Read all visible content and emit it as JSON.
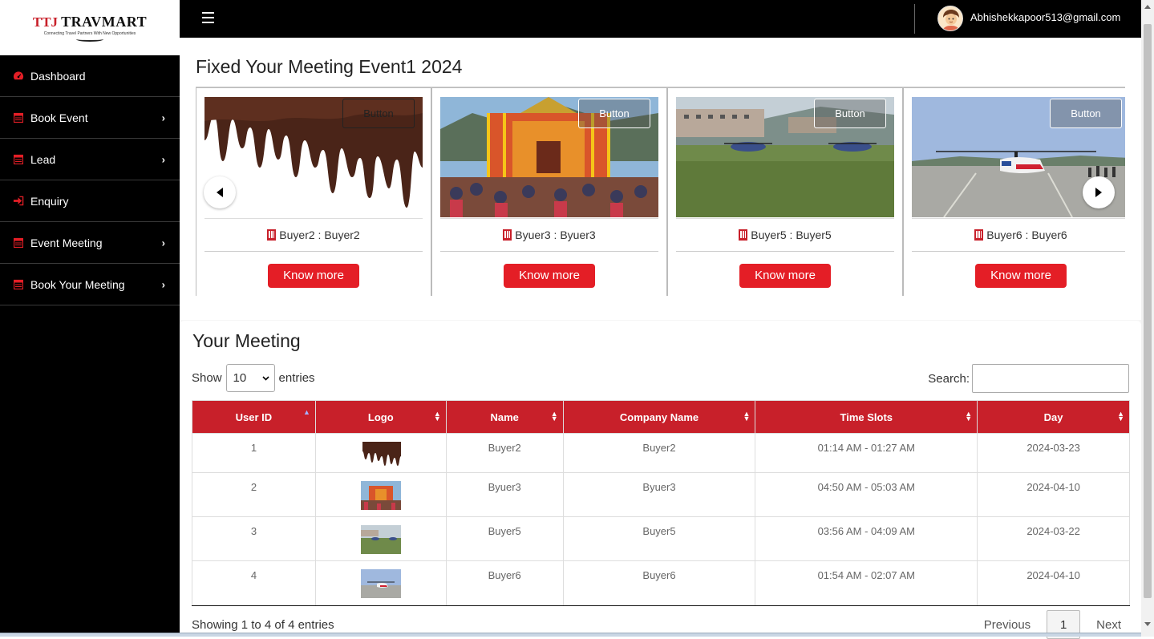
{
  "brand": {
    "logo_mark": "TTJ",
    "logo_name": "TRAVMART",
    "logo_tagline": "Connecting Travel Partners With New Opportunities"
  },
  "sidebar": {
    "items": [
      {
        "label": "Dashboard",
        "icon": "dashboard-icon",
        "has_submenu": false
      },
      {
        "label": "Book Event",
        "icon": "calendar-icon",
        "has_submenu": true
      },
      {
        "label": "Lead",
        "icon": "calendar-icon",
        "has_submenu": true
      },
      {
        "label": "Enquiry",
        "icon": "sign-in-icon",
        "has_submenu": false
      },
      {
        "label": "Event Meeting",
        "icon": "calendar-icon",
        "has_submenu": true
      },
      {
        "label": "Book Your Meeting",
        "icon": "calendar-icon",
        "has_submenu": true
      }
    ]
  },
  "topbar": {
    "user_email": "Abhishekkapoor513@gmail.com"
  },
  "carousel": {
    "title": "Fixed Your Meeting Event1 2024",
    "slides": [
      {
        "name": "Buyer2 : Buyer2",
        "button": "Button",
        "cta": "Know more",
        "image": "chocolate-drip"
      },
      {
        "name": "Byuer3 : Byuer3",
        "button": "Button",
        "cta": "Know more",
        "image": "temple"
      },
      {
        "name": "Buyer5 : Buyer5",
        "button": "Button",
        "cta": "Know more",
        "image": "helipad-field"
      },
      {
        "name": "Buyer6 : Buyer6",
        "button": "Button",
        "cta": "Know more",
        "image": "helicopter"
      }
    ]
  },
  "meetings": {
    "title": "Your Meeting",
    "show_label": "Show",
    "entries_label": "entries",
    "page_length": "10",
    "search_label": "Search:",
    "search_value": "",
    "columns": [
      "User ID",
      "Logo",
      "Name",
      "Company Name",
      "Time Slots",
      "Day"
    ],
    "rows": [
      {
        "id": "1",
        "logo": "chocolate-drip",
        "name": "Buyer2",
        "company": "Buyer2",
        "slot": "01:14 AM - 01:27 AM",
        "day": "2024-03-23"
      },
      {
        "id": "2",
        "logo": "temple",
        "name": "Byuer3",
        "company": "Byuer3",
        "slot": "04:50 AM - 05:03 AM",
        "day": "2024-04-10"
      },
      {
        "id": "3",
        "logo": "helipad-field",
        "name": "Buyer5",
        "company": "Buyer5",
        "slot": "03:56 AM - 04:09 AM",
        "day": "2024-03-22"
      },
      {
        "id": "4",
        "logo": "helicopter",
        "name": "Buyer6",
        "company": "Buyer6",
        "slot": "01:54 AM - 02:07 AM",
        "day": "2024-04-10"
      }
    ],
    "info": "Showing 1 to 4 of 4 entries",
    "pager": {
      "previous": "Previous",
      "current": "1",
      "next": "Next"
    }
  },
  "colors": {
    "accent": "#c8202a",
    "button_red": "#e41e26",
    "sidebar_bg": "#000000"
  }
}
